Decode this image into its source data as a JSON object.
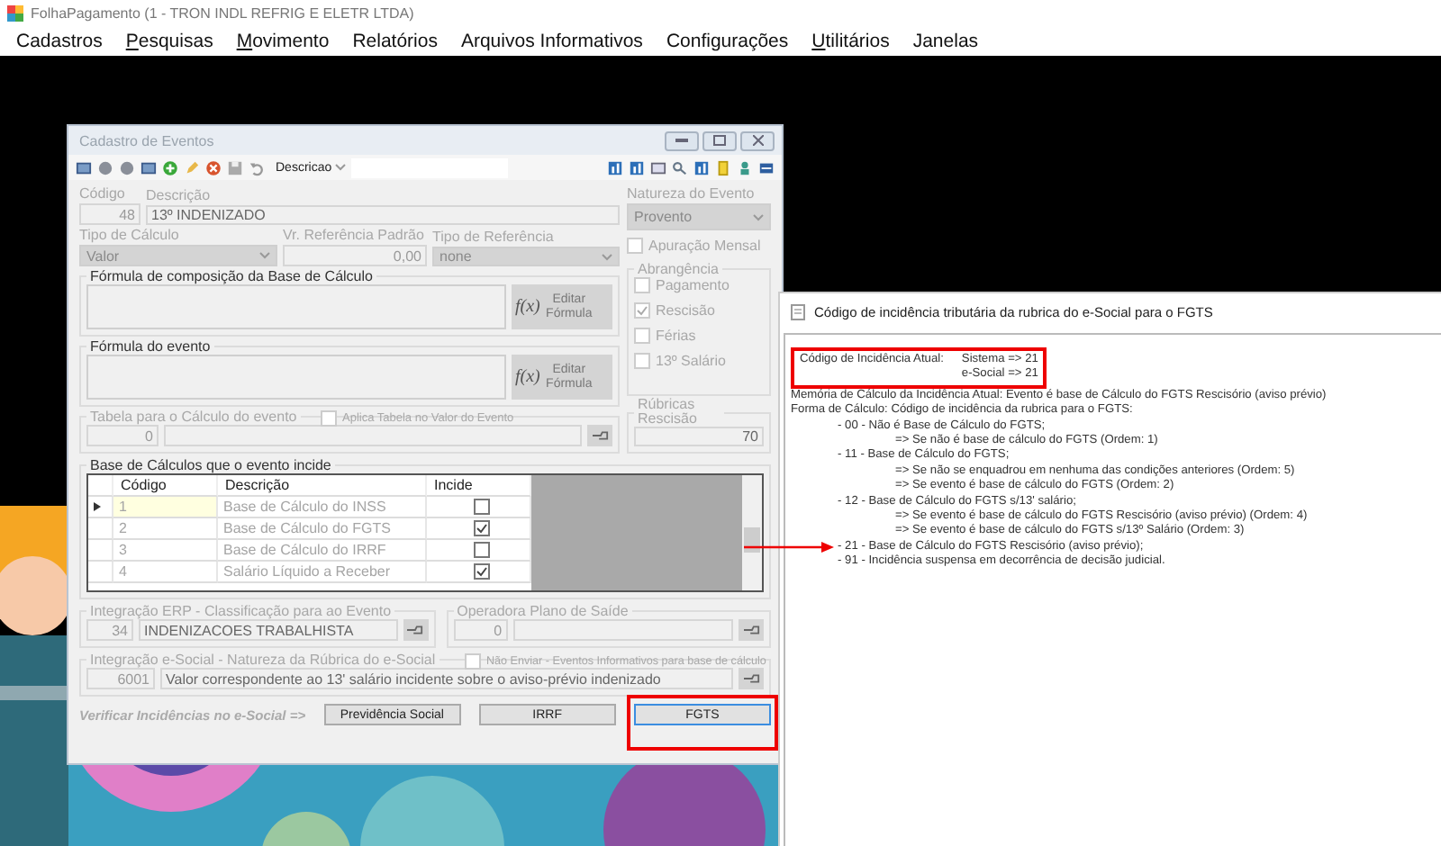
{
  "app": {
    "title": "FolhaPagamento (1 - TRON INDL REFRIG E ELETR LTDA)",
    "menu": [
      {
        "label": "Cadastros",
        "mnemonic": false
      },
      {
        "label": "Pesquisas",
        "mnemonic": true
      },
      {
        "label": "Movimento",
        "mnemonic": true
      },
      {
        "label": "Relatórios",
        "mnemonic": false
      },
      {
        "label": "Arquivos Informativos",
        "mnemonic": false
      },
      {
        "label": "Configurações",
        "mnemonic": false
      },
      {
        "label": "Utilitários",
        "mnemonic": true
      },
      {
        "label": "Janelas",
        "mnemonic": false
      }
    ]
  },
  "dialog": {
    "title": "Cadastro de Eventos",
    "search_mode": "Descricao",
    "code_label": "Código",
    "code": "48",
    "description_label": "Descrição",
    "description": "13º INDENIZADO",
    "nature_label": "Natureza do Evento",
    "nature": "Provento",
    "monthly": {
      "label": "Apuração Mensal",
      "checked": false
    },
    "calc_type_label": "Tipo de Cálculo",
    "calc_type": "Valor",
    "ref_value_label": "Vr. Referência Padrão",
    "ref_value": "0,00",
    "ref_type_label": "Tipo de Referência",
    "ref_type": "none",
    "scope": {
      "title": "Abrangência",
      "items": [
        {
          "label": "Pagamento",
          "checked": false
        },
        {
          "label": "Rescisão",
          "checked": true
        },
        {
          "label": "Férias",
          "checked": false
        },
        {
          "label": "13º Salário",
          "checked": false
        }
      ]
    },
    "formulas": [
      {
        "title": "Fórmula de composição da Base de Cálculo",
        "fx": "f(x)",
        "button": "Editar Fórmula"
      },
      {
        "title": "Fórmula do evento",
        "fx": "f(x)",
        "button": "Editar Fórmula"
      }
    ],
    "calc_table": {
      "title": "Tabela para o Cálculo do evento",
      "apply": {
        "label": "Aplica Tabela no Valor do Evento",
        "checked": false
      },
      "code": "0"
    },
    "rubricas": {
      "title": "Rúbricas Rescisão",
      "value": "70"
    },
    "bases": {
      "title": "Base de Cálculos que o evento incide",
      "columns": [
        "Código",
        "Descrição",
        "Incide"
      ],
      "rows": [
        {
          "code": "1",
          "description": "Base de Cálculo do INSS",
          "incide": false,
          "selected": true
        },
        {
          "code": "2",
          "description": "Base de Cálculo do FGTS",
          "incide": true,
          "selected": false
        },
        {
          "code": "3",
          "description": "Base de Cálculo do IRRF",
          "incide": false,
          "selected": false
        },
        {
          "code": "4",
          "description": "Salário Líquido a Receber",
          "incide": true,
          "selected": false
        }
      ]
    },
    "erp": {
      "title": "Integração ERP - Classificação para ao Evento",
      "code": "34",
      "value": "INDENIZACOES TRABALHISTA"
    },
    "operator": {
      "title": "Operadora Plano de Saíde",
      "code": "0"
    },
    "esocial": {
      "title": "Integração e-Social - Natureza da Rúbrica do e-Social",
      "skip": {
        "label": "Não Enviar - Eventos Informativos para base de cálculo",
        "checked": false
      },
      "code": "6001",
      "value": "Valor correspondente ao 13' salário incidente sobre o aviso-prévio indenizado"
    },
    "verify_label": "Verificar Incidências no e-Social =>",
    "buttons": [
      {
        "label": "Previdência Social",
        "highlighted": false
      },
      {
        "label": "IRRF",
        "highlighted": false
      },
      {
        "label": "FGTS",
        "highlighted": true
      }
    ]
  },
  "incidence": {
    "title": "Código de incidência tributária da rubrica do e-Social para o FGTS",
    "current": {
      "label": "Código de Incidência Atual:",
      "lines": [
        "Sistema => 21",
        "e-Social => 21"
      ],
      "highlighted": true
    },
    "memory": "Memória de Cálculo da Incidência Atual: Evento é base de Cálculo do FGTS Rescisório (aviso prévio)",
    "method": "Forma de Cálculo: Código de incidência da rubrica para o FGTS:",
    "codes": [
      {
        "label": "- 00 - Não é Base de Cálculo do FGTS;",
        "pointed": false,
        "children": [
          {
            "label": "=> Se não é base de cálculo do FGTS (Ordem: 1)"
          }
        ]
      },
      {
        "label": "- 11 - Base de Cálculo do FGTS;",
        "pointed": false,
        "children": [
          {
            "label": "=> Se não se enquadrou em nenhuma das condições anteriores (Ordem: 5)"
          },
          {
            "label": "=> Se evento é base de cálculo do FGTS (Ordem: 2)"
          }
        ]
      },
      {
        "label": "- 12 - Base de Cálculo do FGTS s/13' salário;",
        "pointed": false,
        "children": [
          {
            "label": "=> Se evento é base de cálculo do FGTS Rescisório (aviso prévio) (Ordem: 4)"
          },
          {
            "label": "=> Se evento é base de cálculo do FGTS s/13º Salário (Ordem: 3)"
          }
        ]
      },
      {
        "label": "- 21 - Base de Cálculo do FGTS Rescisório (aviso prévio);",
        "pointed": true
      },
      {
        "label": "- 91 - Incidência suspensa em decorrência de decisão judicial.",
        "pointed": false
      }
    ]
  }
}
